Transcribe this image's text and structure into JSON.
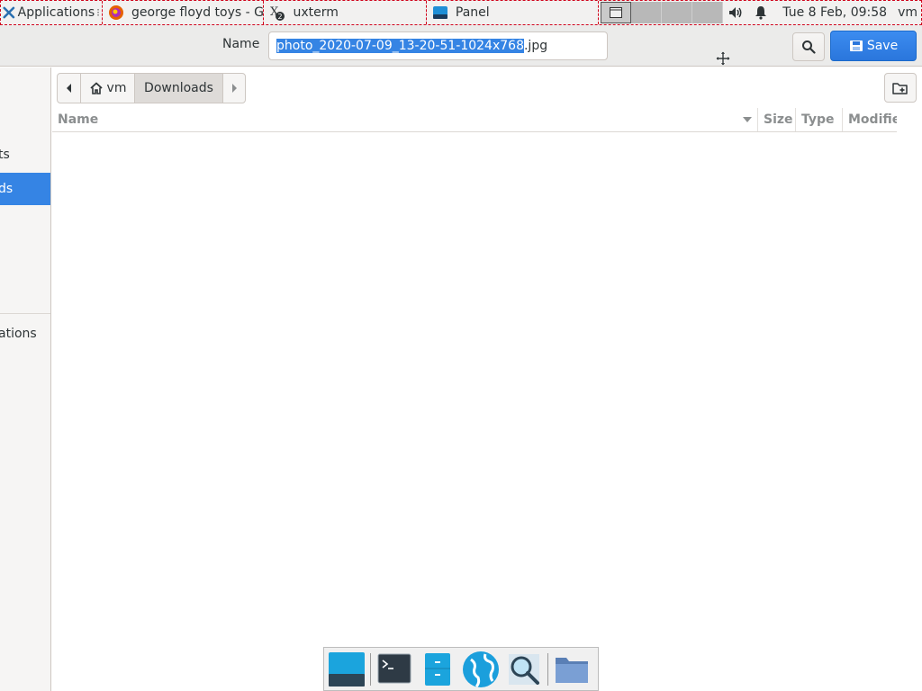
{
  "panel": {
    "app_menu_label": "Applications",
    "tasks": [
      {
        "label": "george floyd toys - G...",
        "icon": "firefox-icon"
      },
      {
        "label": "uxterm",
        "icon": "uxterm-icon"
      },
      {
        "label": "Panel",
        "icon": "panel-icon"
      }
    ],
    "clock": "Tue  8 Feb, 09:58",
    "user": "vm"
  },
  "dialog": {
    "name_label": "Name",
    "filename_selected": "photo_2020-07-09_13-20-51-1024x768",
    "filename_ext": ".jpg",
    "save_label": "Save"
  },
  "sidebar": {
    "items": [
      {
        "label": "ts",
        "selected": false
      },
      {
        "label": "ds",
        "selected": true
      },
      {
        "label": "ations",
        "selected": false
      }
    ]
  },
  "pathbar": {
    "home_label": "vm",
    "current_label": "Downloads"
  },
  "file_list": {
    "columns": {
      "name": "Name",
      "size": "Size",
      "type": "Type",
      "modified": "Modifie"
    },
    "rows": []
  },
  "dock": {
    "items": [
      "desktop-icon",
      "terminal-icon",
      "file-manager-icon",
      "web-browser-icon",
      "app-finder-icon",
      "folder-icon"
    ]
  },
  "colors": {
    "accent": "#3584e4",
    "panel_bg": "#f2f1f0",
    "header_bg": "#ebebea"
  }
}
